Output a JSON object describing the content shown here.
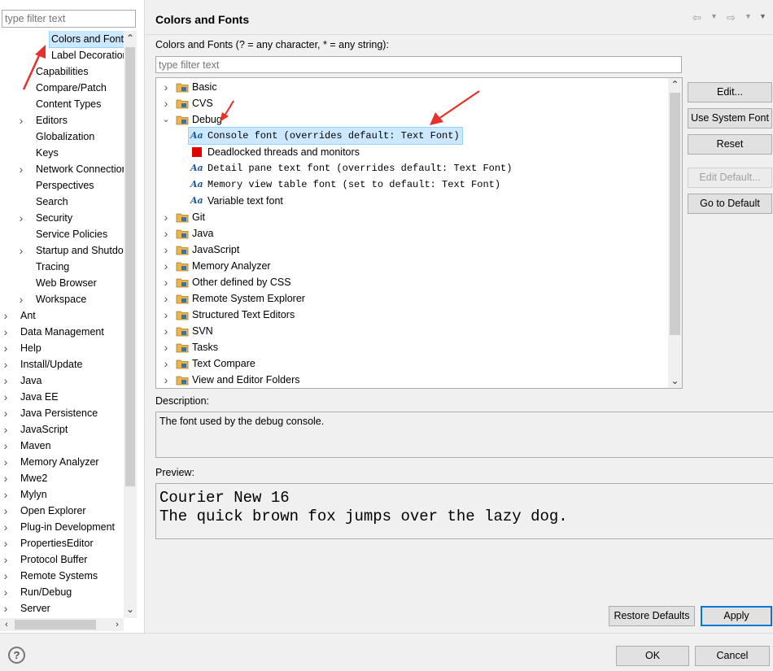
{
  "left": {
    "filter_placeholder": "type filter text",
    "tree": [
      {
        "label": "Colors and Fonts",
        "level": 2,
        "expandable": false,
        "selected": true
      },
      {
        "label": "Label Decorations",
        "level": 2,
        "expandable": false
      },
      {
        "label": "Capabilities",
        "level": 1,
        "expandable": false
      },
      {
        "label": "Compare/Patch",
        "level": 1,
        "expandable": false
      },
      {
        "label": "Content Types",
        "level": 1,
        "expandable": false
      },
      {
        "label": "Editors",
        "level": 1,
        "expandable": true
      },
      {
        "label": "Globalization",
        "level": 1,
        "expandable": false
      },
      {
        "label": "Keys",
        "level": 1,
        "expandable": false
      },
      {
        "label": "Network Connections",
        "level": 1,
        "expandable": true
      },
      {
        "label": "Perspectives",
        "level": 1,
        "expandable": false
      },
      {
        "label": "Search",
        "level": 1,
        "expandable": false
      },
      {
        "label": "Security",
        "level": 1,
        "expandable": true
      },
      {
        "label": "Service Policies",
        "level": 1,
        "expandable": false
      },
      {
        "label": "Startup and Shutdown",
        "level": 1,
        "expandable": true
      },
      {
        "label": "Tracing",
        "level": 1,
        "expandable": false
      },
      {
        "label": "Web Browser",
        "level": 1,
        "expandable": false
      },
      {
        "label": "Workspace",
        "level": 1,
        "expandable": true
      },
      {
        "label": "Ant",
        "level": 0,
        "expandable": true
      },
      {
        "label": "Data Management",
        "level": 0,
        "expandable": true
      },
      {
        "label": "Help",
        "level": 0,
        "expandable": true
      },
      {
        "label": "Install/Update",
        "level": 0,
        "expandable": true
      },
      {
        "label": "Java",
        "level": 0,
        "expandable": true
      },
      {
        "label": "Java EE",
        "level": 0,
        "expandable": true
      },
      {
        "label": "Java Persistence",
        "level": 0,
        "expandable": true
      },
      {
        "label": "JavaScript",
        "level": 0,
        "expandable": true
      },
      {
        "label": "Maven",
        "level": 0,
        "expandable": true
      },
      {
        "label": "Memory Analyzer",
        "level": 0,
        "expandable": true
      },
      {
        "label": "Mwe2",
        "level": 0,
        "expandable": true
      },
      {
        "label": "Mylyn",
        "level": 0,
        "expandable": true
      },
      {
        "label": "Open Explorer",
        "level": 0,
        "expandable": true
      },
      {
        "label": "Plug-in Development",
        "level": 0,
        "expandable": true
      },
      {
        "label": "PropertiesEditor",
        "level": 0,
        "expandable": true
      },
      {
        "label": "Protocol Buffer",
        "level": 0,
        "expandable": true
      },
      {
        "label": "Remote Systems",
        "level": 0,
        "expandable": true
      },
      {
        "label": "Run/Debug",
        "level": 0,
        "expandable": true
      },
      {
        "label": "Server",
        "level": 0,
        "expandable": true
      }
    ]
  },
  "right": {
    "title": "Colors and Fonts",
    "filter_label": "Colors and Fonts (? = any character, * = any string):",
    "filter_placeholder": "type filter text",
    "tree": [
      {
        "label": "Basic",
        "kind": "folder",
        "level": 0,
        "expanded": false
      },
      {
        "label": "CVS",
        "kind": "folder",
        "level": 0,
        "expanded": false
      },
      {
        "label": "Debug",
        "kind": "folder",
        "level": 0,
        "expanded": true
      },
      {
        "label": "Console font (overrides default: Text Font)",
        "kind": "font",
        "level": 1,
        "selected": true
      },
      {
        "label": "Deadlocked threads and monitors",
        "kind": "color",
        "level": 1,
        "color": "#e00000"
      },
      {
        "label": "Detail pane text font (overrides default: Text Font)",
        "kind": "font",
        "level": 1
      },
      {
        "label": "Memory view table font (set to default: Text Font)",
        "kind": "font",
        "level": 1
      },
      {
        "label": "Variable text font",
        "kind": "font",
        "level": 1,
        "sans": true
      },
      {
        "label": "Git",
        "kind": "folder",
        "level": 0,
        "expanded": false
      },
      {
        "label": "Java",
        "kind": "folder",
        "level": 0,
        "expanded": false
      },
      {
        "label": "JavaScript",
        "kind": "folder",
        "level": 0,
        "expanded": false
      },
      {
        "label": "Memory Analyzer",
        "kind": "folder",
        "level": 0,
        "expanded": false
      },
      {
        "label": "Other defined by CSS",
        "kind": "folder",
        "level": 0,
        "expanded": false
      },
      {
        "label": "Remote System Explorer",
        "kind": "folder",
        "level": 0,
        "expanded": false
      },
      {
        "label": "Structured Text Editors",
        "kind": "folder",
        "level": 0,
        "expanded": false
      },
      {
        "label": "SVN",
        "kind": "folder",
        "level": 0,
        "expanded": false
      },
      {
        "label": "Tasks",
        "kind": "folder",
        "level": 0,
        "expanded": false
      },
      {
        "label": "Text Compare",
        "kind": "folder",
        "level": 0,
        "expanded": false
      },
      {
        "label": "View and Editor Folders",
        "kind": "folder",
        "level": 0,
        "expanded": false
      }
    ],
    "aa_glyph": "Aa",
    "buttons": {
      "edit": "Edit...",
      "use_system_font": "Use System Font",
      "reset": "Reset",
      "edit_default": "Edit Default...",
      "go_to_default": "Go to Default"
    },
    "description_label": "Description:",
    "description_text": "The font used by the debug console.",
    "preview_label": "Preview:",
    "preview_text": "Courier New 16\nThe quick brown fox jumps over the lazy dog.",
    "restore_defaults": "Restore Defaults",
    "apply": "Apply"
  },
  "footer": {
    "ok": "OK",
    "cancel": "Cancel",
    "help_glyph": "?"
  },
  "colors": {
    "selection": "#cce8ff",
    "annotation_arrow": "#e8312a",
    "folder": "#e8b64a",
    "default_button_border": "#0078d7"
  }
}
